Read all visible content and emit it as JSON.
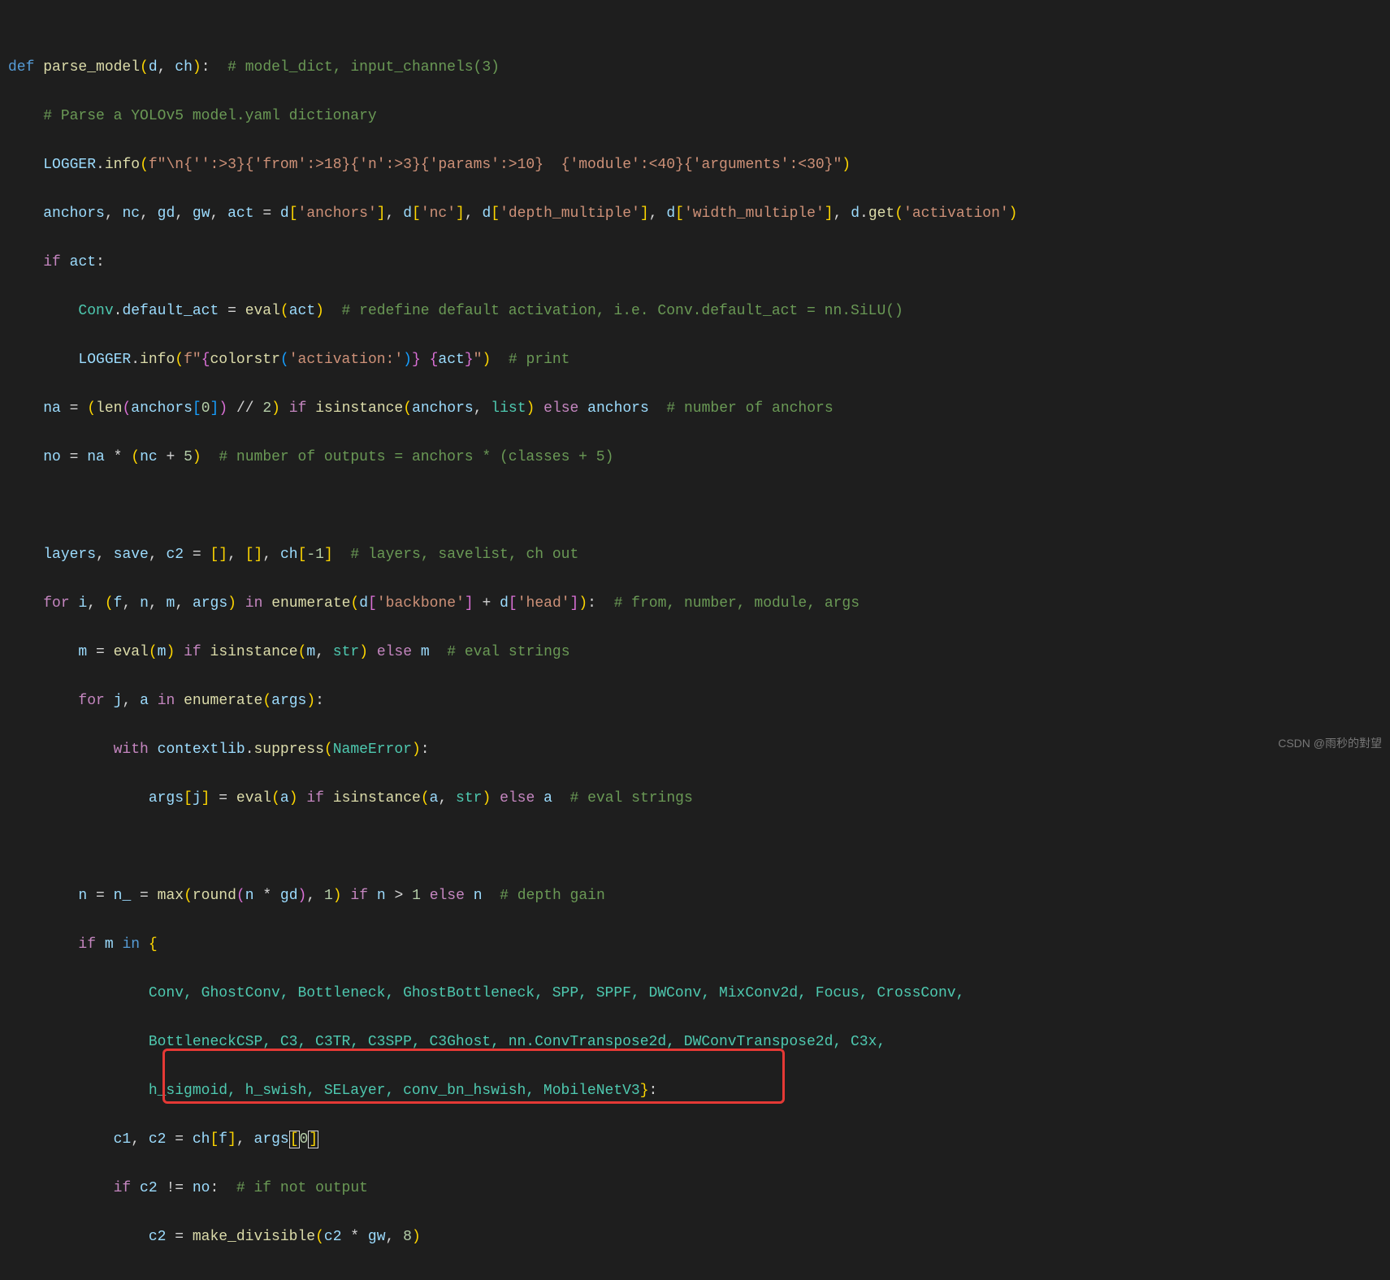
{
  "watermark": "CSDN @雨秒的對望",
  "code": {
    "l1": {
      "def": "def",
      "name": "parse_model",
      "p1": "d",
      "p2": "ch",
      "cmt": "# model_dict, input_channels(3)"
    },
    "l2": {
      "cmt": "# Parse a YOLOv5 model.yaml dictionary"
    },
    "l3": {
      "log": "LOGGER",
      "info": "info",
      "s1": "f\"\\n{",
      "s1b": "''",
      "s2": ":>3}{",
      "s2b": "'from'",
      "s3": ":>18}{",
      "s3b": "'n'",
      "s4": ":>3}{",
      "s4b": "'params'",
      "s5": ":>10}  {",
      "s5b": "'module'",
      "s6": ":<40}{",
      "s6b": "'arguments'",
      "s7": ":<30}\""
    },
    "l4": {
      "v1": "anchors",
      "v2": "nc",
      "v3": "gd",
      "v4": "gw",
      "v5": "act",
      "v6": "d",
      "k1": "'anchors'",
      "k2": "'nc'",
      "k3": "'depth_multiple'",
      "k4": "'width_multiple'",
      "get": "get",
      "k5": "'activation'"
    },
    "l5": {
      "kw": "if",
      "v": "act"
    },
    "l6": {
      "conv": "Conv",
      "attr": "default_act",
      "ev": "eval",
      "a": "act",
      "cmt": "# redefine default activation, i.e. Conv.default_act = nn.SiLU()"
    },
    "l7": {
      "log": "LOGGER",
      "info": "info",
      "cs": "colorstr",
      "s1": "'activation:'",
      "act": "act",
      "cmt": "# print"
    },
    "l8": {
      "na": "na",
      "len": "len",
      "an": "anchors",
      "z": "0",
      "two": "2",
      "inst": "isinstance",
      "list": "list",
      "an2": "anchors",
      "cmt": "# number of anchors"
    },
    "l9": {
      "no": "no",
      "na": "na",
      "nc": "nc",
      "five": "5",
      "cmt": "# number of outputs = anchors * (classes + 5)"
    },
    "l10": {},
    "l11": {
      "lay": "layers",
      "save": "save",
      "c2": "c2",
      "ch": "ch",
      "m1": "-1",
      "cmt": "# layers, savelist, ch out"
    },
    "l12": {
      "for": "for",
      "i": "i",
      "f": "f",
      "n": "n",
      "m": "m",
      "args": "args",
      "in": "in",
      "enum": "enumerate",
      "d": "d",
      "k1": "'backbone'",
      "k2": "'head'",
      "cmt": "# from, number, module, args"
    },
    "l13": {
      "m": "m",
      "ev": "eval",
      "inst": "isinstance",
      "str": "str",
      "else": "else",
      "cmt": "# eval strings"
    },
    "l14": {
      "for": "for",
      "j": "j",
      "a": "a",
      "in": "in",
      "enum": "enumerate",
      "args": "args"
    },
    "l15": {
      "with": "with",
      "ctx": "contextlib",
      "sup": "suppress",
      "ne": "NameError"
    },
    "l16": {
      "args": "args",
      "j": "j",
      "ev": "eval",
      "a": "a",
      "inst": "isinstance",
      "str": "str",
      "else": "else",
      "cmt": "# eval strings"
    },
    "l17": {},
    "l18": {
      "n": "n",
      "n_": "n_",
      "max": "max",
      "round": "round",
      "gd": "gd",
      "one": "1",
      "if": "if",
      "gt": ">",
      "else": "else",
      "cmt": "# depth gain"
    },
    "l19": {
      "if": "if",
      "m": "m",
      "in": "in"
    },
    "l20": {
      "t": "Conv, GhostConv, Bottleneck, GhostBottleneck, SPP, SPPF, DWConv, MixConv2d, Focus, CrossConv,"
    },
    "l21": {
      "t": "BottleneckCSP, C3, C3TR, C3SPP, C3Ghost, nn.ConvTranspose2d, DWConvTranspose2d, C3x,"
    },
    "l22": {
      "t": "h_sigmoid, h_swish, SELayer, conv_bn_hswish, MobileNetV3"
    },
    "l23": {
      "c1": "c1",
      "c2": "c2",
      "ch": "ch",
      "f": "f",
      "args": "args",
      "z": "0"
    },
    "l24": {
      "if": "if",
      "c2": "c2",
      "no": "no",
      "cmt": "# if not output"
    },
    "l25": {
      "c2": "c2",
      "md": "make_divisible",
      "gw": "gw",
      "eight": "8"
    }
  }
}
